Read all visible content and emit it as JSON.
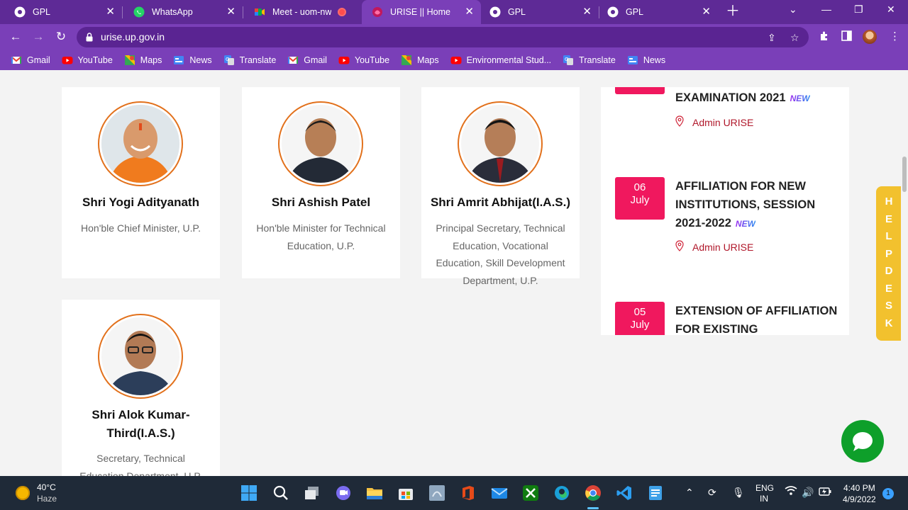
{
  "browser": {
    "tabs": [
      {
        "title": "GPL",
        "icon": "chrome-icon"
      },
      {
        "title": "WhatsApp",
        "icon": "whatsapp-icon"
      },
      {
        "title": "Meet - uom-nw",
        "icon": "meet-icon"
      },
      {
        "title": "URISE || Home",
        "icon": "urise-icon",
        "active": true
      },
      {
        "title": "GPL",
        "icon": "chrome-icon"
      },
      {
        "title": "GPL",
        "icon": "chrome-icon"
      }
    ],
    "url": "urise.up.gov.in",
    "theme_color": "#7a3fb8"
  },
  "bookmarks": [
    {
      "label": "Gmail",
      "icon": "gmail-icon"
    },
    {
      "label": "YouTube",
      "icon": "youtube-icon"
    },
    {
      "label": "Maps",
      "icon": "maps-icon"
    },
    {
      "label": "News",
      "icon": "news-icon"
    },
    {
      "label": "Translate",
      "icon": "translate-icon"
    },
    {
      "label": "Gmail",
      "icon": "gmail-icon"
    },
    {
      "label": "YouTube",
      "icon": "youtube-icon"
    },
    {
      "label": "Maps",
      "icon": "maps-icon"
    },
    {
      "label": "Environmental Stud...",
      "icon": "youtube-icon"
    },
    {
      "label": "Translate",
      "icon": "translate-icon"
    },
    {
      "label": "News",
      "icon": "news-icon"
    }
  ],
  "officials": [
    {
      "name": "Shri Yogi Adityanath",
      "title": "Hon'ble Chief Minister, U.P."
    },
    {
      "name": "Shri Ashish Patel",
      "title": "Hon'ble Minister for Technical Education, U.P."
    },
    {
      "name": "Shri Amrit Abhijat(I.A.S.)",
      "title": "Principal Secretary, Technical Education, Vocational Education, Skill Development Department, U.P."
    },
    {
      "name": "Shri Alok Kumar-Third(I.A.S.)",
      "title": "Secretary, Technical Education Department, U.P."
    }
  ],
  "news": [
    {
      "day": "",
      "month": "",
      "title": "EXAMINATION 2021",
      "badge": "NEW",
      "author": "Admin URISE"
    },
    {
      "day": "06",
      "month": "July",
      "title": "AFFILIATION FOR NEW INSTITUTIONS, SESSION 2021-2022",
      "badge": "NEW",
      "author": "Admin URISE"
    },
    {
      "day": "05",
      "month": "July",
      "title": "EXTENSION OF AFFILIATION FOR EXISTING INSTITUTIONS,",
      "badge": "",
      "author": ""
    }
  ],
  "helpdesk": {
    "label": "HELPDESK",
    "color": "#f2c12e"
  },
  "accent_color": "#f0185e",
  "taskbar": {
    "weather_temp": "40°C",
    "weather_desc": "Haze",
    "lang_line1": "ENG",
    "lang_line2": "IN",
    "time": "4:40 PM",
    "date": "4/9/2022",
    "notifications": "1"
  }
}
